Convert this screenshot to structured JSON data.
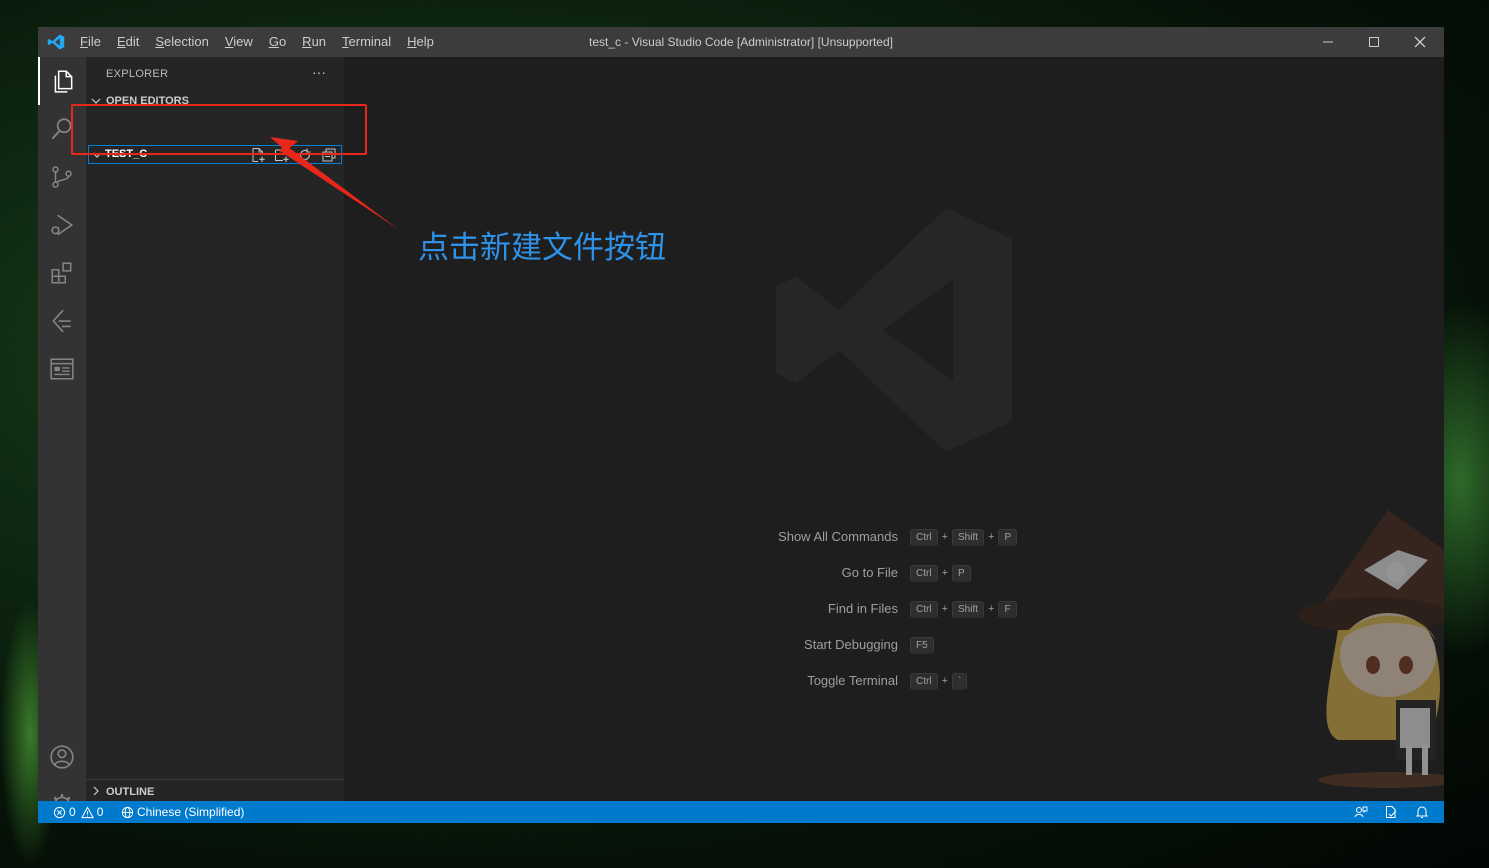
{
  "titlebar": {
    "menus": [
      "File",
      "Edit",
      "Selection",
      "View",
      "Go",
      "Run",
      "Terminal",
      "Help"
    ],
    "title": "test_c - Visual Studio Code [Administrator] [Unsupported]"
  },
  "activitybar": {
    "icons": [
      "explorer-icon",
      "search-icon",
      "source-control-icon",
      "run-debug-icon",
      "extensions-icon",
      "remote-icon",
      "panel-icon",
      "account-icon",
      "settings-gear-icon"
    ]
  },
  "sidebar": {
    "header": "EXPLORER",
    "more": "···",
    "open_editors": "OPEN EDITORS",
    "folder": "TEST_C",
    "outline": "OUTLINE"
  },
  "editor": {
    "shortcuts": [
      {
        "label": "Show All Commands",
        "keys": [
          "Ctrl",
          "Shift",
          "P"
        ]
      },
      {
        "label": "Go to File",
        "keys": [
          "Ctrl",
          "P"
        ]
      },
      {
        "label": "Find in Files",
        "keys": [
          "Ctrl",
          "Shift",
          "F"
        ]
      },
      {
        "label": "Start Debugging",
        "keys": [
          "F5"
        ]
      },
      {
        "label": "Toggle Terminal",
        "keys": [
          "Ctrl",
          "`"
        ]
      }
    ]
  },
  "statusbar": {
    "errors": "0",
    "warnings": "0",
    "language": "Chinese (Simplified)"
  },
  "annotation": {
    "text": "点击新建文件按钮",
    "color": "#2e92e8",
    "box_color": "#e8271b"
  },
  "colors": {
    "accent": "#007acc",
    "titlebar": "#3c3c3c",
    "activitybar": "#333333",
    "sidebar": "#252526",
    "editor": "#1e1e1e"
  }
}
